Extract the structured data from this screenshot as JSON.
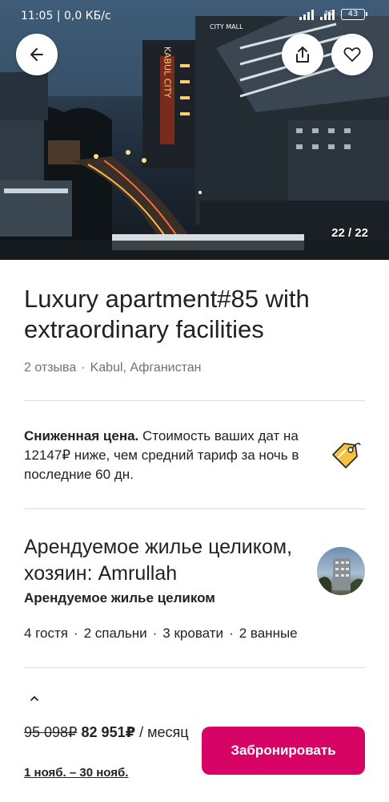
{
  "status_bar": {
    "time": "11:05 | 0,0 КБ/с",
    "network": "4G",
    "battery": "43"
  },
  "hero": {
    "photo_counter": "22 / 22",
    "sign_text": "KABUL CITY",
    "top_sign": "CITY MALL"
  },
  "listing": {
    "title": "Luxury apartment#85 with extraordinary facilities",
    "reviews": "2 отзыва",
    "separator": "·",
    "location": "Kabul, Афганистан"
  },
  "price_note": {
    "bold": "Сниженная цена.",
    "text": " Стоимость ваших дат на 12147₽ ниже, чем средний тариф за ночь в последние 60 дн."
  },
  "host": {
    "title": "Арендуемое жилье целиком, хозяин: Amrullah",
    "subtitle": "Арендуемое жилье целиком"
  },
  "features": {
    "guests": "4 гостя",
    "bedrooms": "2 спальни",
    "beds": "3 кровати",
    "baths": "2 ванные"
  },
  "footer": {
    "old_price": "95 098₽",
    "new_price": "82 951₽",
    "period": " / месяц",
    "dates": "1 нояб. – 30 нояб.",
    "book_label": "Забронировать"
  },
  "colors": {
    "accent": "#d70466",
    "muted": "#717171",
    "divider": "#dddddd"
  }
}
